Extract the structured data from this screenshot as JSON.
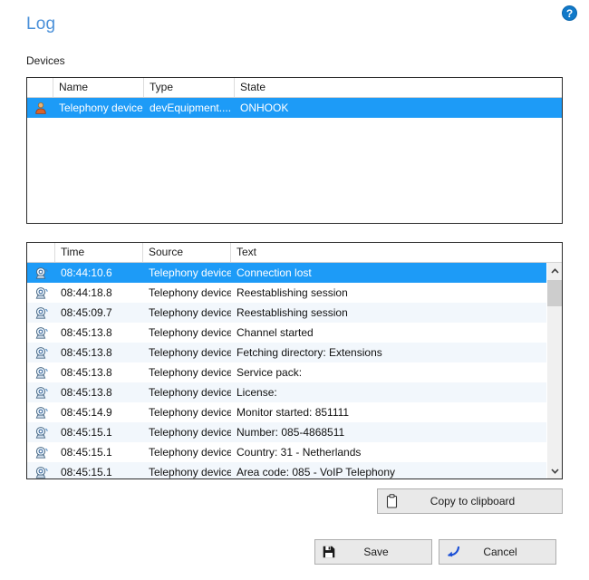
{
  "header": {
    "title": "Log",
    "help_icon": "help-circle-icon",
    "help_label": "?"
  },
  "devices_section": {
    "label": "Devices",
    "columns": [
      "",
      "Name",
      "Type",
      "State"
    ],
    "rows": [
      {
        "icon": "user-device-icon",
        "name": "Telephony device",
        "type": "devEquipment....",
        "state": "ONHOOK",
        "selected": true
      }
    ]
  },
  "log_section": {
    "columns": [
      "",
      "Time",
      "Source",
      "Text"
    ],
    "rows": [
      {
        "icon": "device-monitor-icon",
        "time": "08:44:10.6",
        "source": "Telephony device",
        "text": "Connection lost",
        "selected": true
      },
      {
        "icon": "device-monitor-icon",
        "time": "08:44:18.8",
        "source": "Telephony device",
        "text": "Reestablishing session",
        "selected": false
      },
      {
        "icon": "device-monitor-icon",
        "time": "08:45:09.7",
        "source": "Telephony device",
        "text": "Reestablishing session",
        "selected": false
      },
      {
        "icon": "device-monitor-icon",
        "time": "08:45:13.8",
        "source": "Telephony device",
        "text": "Channel started",
        "selected": false
      },
      {
        "icon": "device-monitor-icon",
        "time": "08:45:13.8",
        "source": "Telephony device",
        "text": "Fetching directory: Extensions",
        "selected": false
      },
      {
        "icon": "device-monitor-icon",
        "time": "08:45:13.8",
        "source": "Telephony device",
        "text": "Service pack:",
        "selected": false
      },
      {
        "icon": "device-monitor-icon",
        "time": "08:45:13.8",
        "source": "Telephony device",
        "text": "License:",
        "selected": false
      },
      {
        "icon": "device-monitor-icon",
        "time": "08:45:14.9",
        "source": "Telephony device",
        "text": "Monitor started: 851111",
        "selected": false
      },
      {
        "icon": "device-monitor-icon",
        "time": "08:45:15.1",
        "source": "Telephony device",
        "text": "Number: 085-4868511",
        "selected": false
      },
      {
        "icon": "device-monitor-icon",
        "time": "08:45:15.1",
        "source": "Telephony device",
        "text": "Country: 31 - Netherlands",
        "selected": false
      },
      {
        "icon": "device-monitor-icon",
        "time": "08:45:15.1",
        "source": "Telephony device",
        "text": "Area code: 085 - VoIP Telephony",
        "selected": false
      }
    ],
    "scrollbar": {
      "up_arrow": "chevron-up-icon",
      "down_arrow": "chevron-down-icon"
    }
  },
  "buttons": {
    "copy": {
      "label": "Copy to clipboard",
      "icon": "clipboard-icon"
    },
    "save": {
      "label": "Save",
      "icon": "floppy-disk-icon"
    },
    "cancel": {
      "label": "Cancel",
      "icon": "back-arrow-icon"
    }
  },
  "colors": {
    "title": "#4a90d9",
    "selection": "#1d9bf7",
    "row_alt": "#f2f7fc",
    "help": "#1179c9",
    "button_face": "#e9e9e9",
    "cancel_arrow": "#1a4fd6"
  }
}
